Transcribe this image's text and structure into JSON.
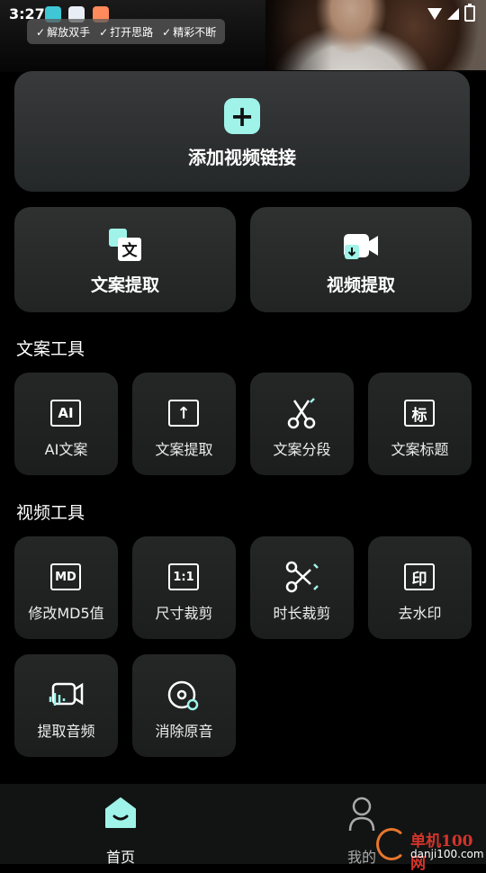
{
  "status_bar": {
    "time": "3:27",
    "app_icons": [
      "cat-app-icon",
      "calendar-app-icon",
      "health-app-icon"
    ],
    "right_icons": [
      "wifi-icon",
      "signal-icon",
      "battery-icon"
    ]
  },
  "banner": {
    "tags": [
      "解放双手",
      "打开思路",
      "精彩不断"
    ],
    "check_glyph": "✓"
  },
  "add_link": {
    "icon": "plus-icon",
    "label": "添加视频链接",
    "accent": "#9ff3e9"
  },
  "big_actions": [
    {
      "icon": "translate-icon",
      "label": "文案提取"
    },
    {
      "icon": "video-download-icon",
      "label": "视频提取"
    }
  ],
  "copy_tools": {
    "title": "文案工具",
    "items": [
      {
        "icon": "ai-icon",
        "glyph": "AI",
        "label": "AI文案"
      },
      {
        "icon": "upload-icon",
        "glyph": "↑",
        "label": "文案提取"
      },
      {
        "icon": "scissors-icon",
        "glyph": "",
        "label": "文案分段"
      },
      {
        "icon": "title-icon",
        "glyph": "标",
        "label": "文案标题"
      }
    ]
  },
  "video_tools": {
    "title": "视频工具",
    "items": [
      {
        "icon": "md5-icon",
        "glyph": "MD",
        "label": "修改MD5值"
      },
      {
        "icon": "ratio-icon",
        "glyph": "1:1",
        "label": "尺寸裁剪"
      },
      {
        "icon": "cut-duration-icon",
        "glyph": "",
        "label": "时长裁剪"
      },
      {
        "icon": "stamp-icon",
        "glyph": "印",
        "label": "去水印"
      },
      {
        "icon": "audio-extract-icon",
        "glyph": "",
        "label": "提取音频"
      },
      {
        "icon": "mute-icon",
        "glyph": "",
        "label": "消除原音"
      }
    ]
  },
  "bottom_nav": [
    {
      "icon": "home-icon",
      "label": "首页",
      "active": true
    },
    {
      "icon": "profile-icon",
      "label": "我的",
      "active": false
    }
  ],
  "watermark": {
    "line1": "单机100网",
    "line2": "danji100.com"
  }
}
